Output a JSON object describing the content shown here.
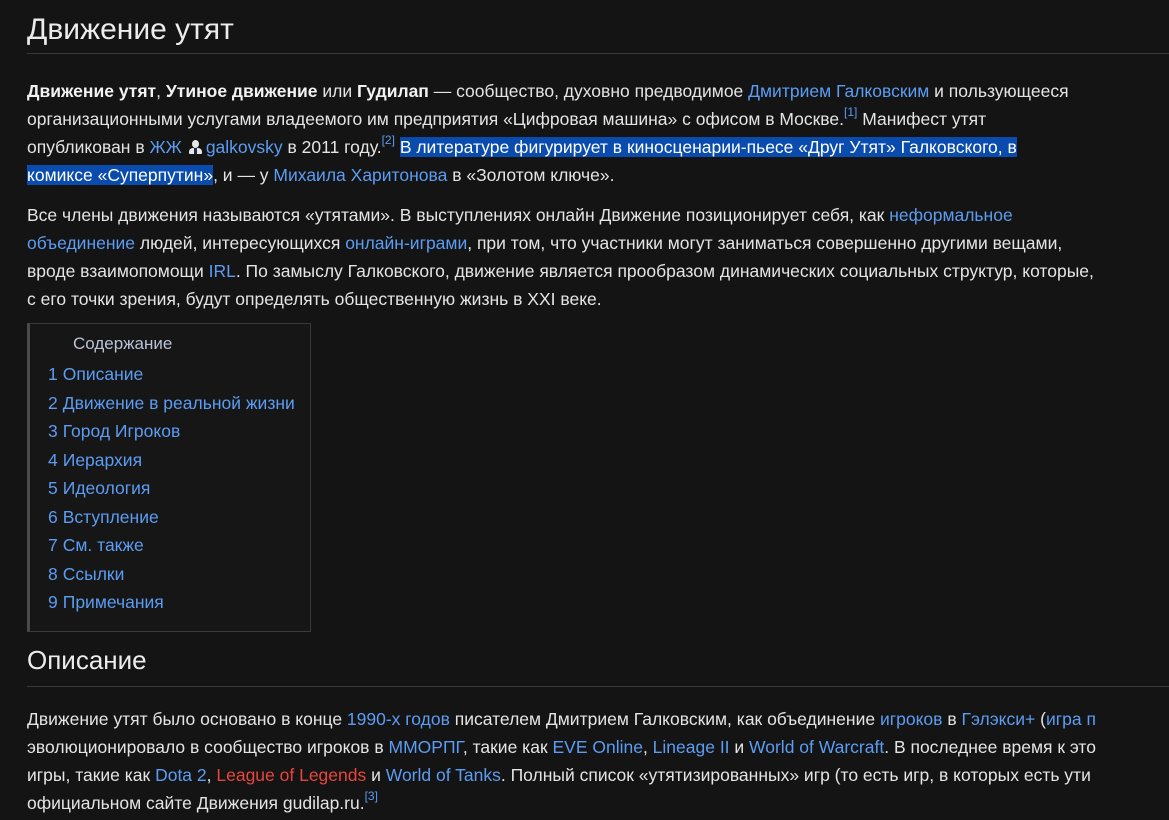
{
  "title": "Движение утят",
  "intro": {
    "bold1": "Движение утят",
    "sep1": ", ",
    "bold2": "Утиное движение",
    "or": " или ",
    "bold3": "Гудилап",
    "t1": " — сообщество, духовно предводимое ",
    "link_galkovsky": "Дмитрием Галковским",
    "t2": " и пользующееся",
    "t3": "организационными услугами владеемого им предприятия «Цифровая машина» с офисом в Москве.",
    "ref1": "[1]",
    "t4": " Манифест утят",
    "t5": "опубликован в ",
    "link_lj": "ЖЖ",
    "link_user": "galkovsky",
    "t6": " в 2011 году.",
    "ref2": "[2]",
    "sel1": "В литературе фигурирует в киносценарии-пьесе «Друг Утят» Галковского, в",
    "sel2": "комиксе «Суперпутин»",
    "t7": ", и — у ",
    "link_kharitonov": "Михаила Харитонова",
    "t8": " в «Золотом ключе»."
  },
  "para2": {
    "t1": "Все члены движения называются «утятами». В выступлениях онлайн Движение позиционирует себя, как ",
    "link1a": "неформальное",
    "link1b": "объединение",
    "t2": " людей, интересующихся ",
    "link2": "онлайн-играми",
    "t3": ", при том, что участники могут заниматься совершенно другими вещами,",
    "t4": "вроде взаимопомощи ",
    "link3": "IRL",
    "t5": ". По замыслу Галковского, движение является прообразом динамических социальных структур, которые,",
    "t6": "с его точки зрения, будут определять общественную жизнь в XXI веке."
  },
  "toc": {
    "title": "Содержание",
    "items": [
      {
        "num": "1",
        "label": "Описание"
      },
      {
        "num": "2",
        "label": "Движение в реальной жизни"
      },
      {
        "num": "3",
        "label": "Город Игроков"
      },
      {
        "num": "4",
        "label": "Иерархия"
      },
      {
        "num": "5",
        "label": "Идеология"
      },
      {
        "num": "6",
        "label": "Вступление"
      },
      {
        "num": "7",
        "label": "См. также"
      },
      {
        "num": "8",
        "label": "Ссылки"
      },
      {
        "num": "9",
        "label": "Примечания"
      }
    ]
  },
  "section1": {
    "heading": "Описание",
    "l1_t1": "Движение утят было основано в конце ",
    "l1_link1": "1990-х годов",
    "l1_t2": " писателем Дмитрием Галковским, как объединение ",
    "l1_link2": "игроков",
    "l1_t3": " в ",
    "l1_link3": "Гэлэкси+",
    "l1_t4": " (",
    "l1_link4": "игра п",
    "l2_t1": "эволюционировало в сообщество игроков в ",
    "l2_link1": "ММОРПГ",
    "l2_t2": ", такие как ",
    "l2_link2": "EVE Online",
    "l2_t3": ", ",
    "l2_link3": "Lineage II",
    "l2_t4": " и ",
    "l2_link4": "World of Warcraft",
    "l2_t5": ". В последнее время к это",
    "l3_t1": "игры, такие как ",
    "l3_link1": "Dota 2",
    "l3_t2": ", ",
    "l3_red": "League of Legends",
    "l3_t3": " и ",
    "l3_link2": "World of Tanks",
    "l3_t4": ". Полный список «утятизированных» игр (то есть игр, в которых есть ути",
    "l4_t1": "официальном сайте Движения gudilap.ru.",
    "ref3": "[3]"
  },
  "colors": {
    "background": "#141414",
    "text": "#e4e4e4",
    "link": "#5c9cf2",
    "redlink": "#e8453c",
    "selection": "#0a4cad"
  }
}
